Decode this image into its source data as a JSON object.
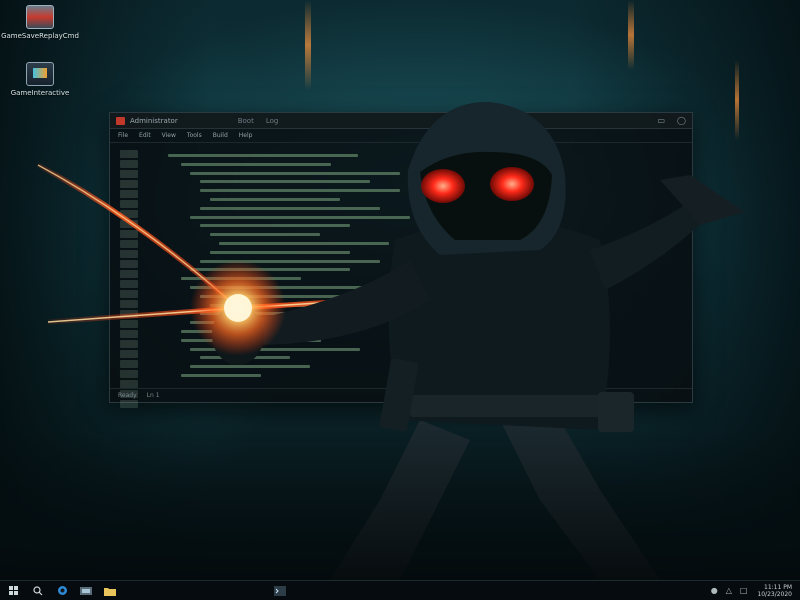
{
  "desktop": {
    "icons": [
      {
        "label": "GameSaveReplayCmd",
        "icon": "app-icon"
      },
      {
        "label": "GameInteractive",
        "icon": "monitor-icon"
      }
    ]
  },
  "window": {
    "title": "Administrator",
    "tab": "Boot",
    "tab2": "Log",
    "menu": [
      "File",
      "Edit",
      "View",
      "Tools",
      "Build",
      "Help"
    ],
    "status": [
      "Ready",
      "Ln 1"
    ],
    "gutter_rows": 26
  },
  "taskbar": {
    "buttons": [
      "start-icon",
      "search-icon",
      "browser-icon",
      "file-explorer-icon",
      "folder-icon",
      "terminal-app-icon"
    ],
    "tray": [
      "network-icon",
      "volume-icon",
      "notification-icon"
    ],
    "clock": {
      "time": "11:11 PM",
      "date": "10/23/2020"
    }
  },
  "colors": {
    "accent": "#ff4a1a",
    "glow": "#ffcf6a",
    "eyes": "#ff2a1a",
    "terminal_text": "#96c896",
    "wallpaper_teal": "#0f3038"
  }
}
